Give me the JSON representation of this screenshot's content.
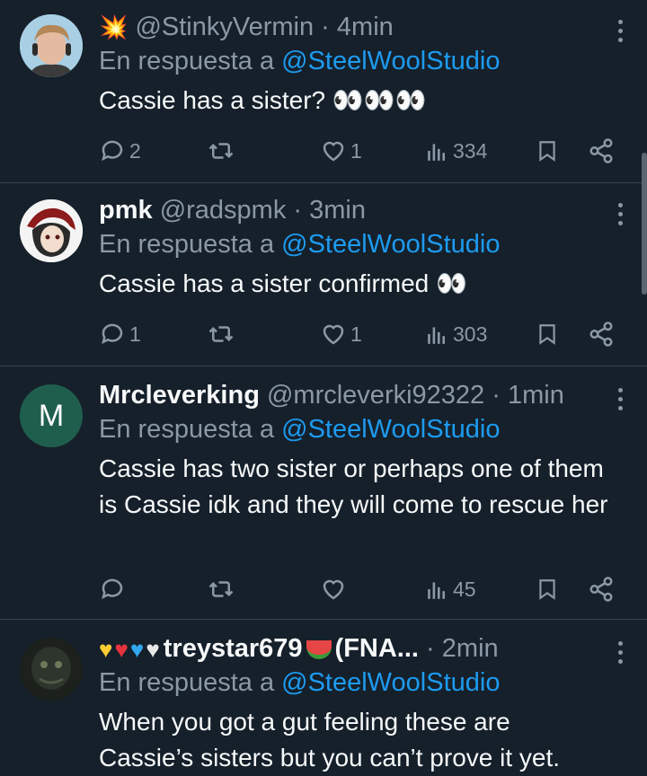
{
  "tweets": [
    {
      "display_name": "",
      "name_prefix_icon": "collision-emoji",
      "handle": "@StinkyVermin",
      "separator": "·",
      "time": "4min",
      "reply_prefix": "En respuesta a",
      "reply_mention": "@SteelWoolStudio",
      "text": "Cassie has a sister? 👀👀👀",
      "replies": "2",
      "retweets": "",
      "likes": "1",
      "views": "334"
    },
    {
      "display_name": "pmk",
      "handle": "@radspmk",
      "separator": "·",
      "time": "3min",
      "reply_prefix": "En respuesta a",
      "reply_mention": "@SteelWoolStudio",
      "text": "Cassie has a sister confirmed 👀",
      "replies": "1",
      "retweets": "",
      "likes": "1",
      "views": "303"
    },
    {
      "display_name": "Mrcleverking",
      "avatar_letter": "M",
      "handle": "@mrcleverki92322",
      "separator": "·",
      "time": "1min",
      "reply_prefix": "En respuesta a",
      "reply_mention": "@SteelWoolStudio",
      "text": "Cassie has two sister or perhaps one of them is Cassie idk and they will come to rescue her",
      "replies": "",
      "retweets": "",
      "likes": "",
      "views": "45"
    },
    {
      "display_name": "treystar679",
      "display_name_suffix": "(FNA...",
      "handle": "",
      "separator": "·",
      "time": "2min",
      "reply_prefix": "En respuesta a",
      "reply_mention": "@SteelWoolStudio",
      "text": "When you got a gut feeling these are Cassie’s sisters but you can’t prove it yet."
    }
  ],
  "colors": {
    "background": "#15202b",
    "accent": "#1d9bf0",
    "muted": "#8b98a5",
    "divider": "#38444d",
    "avatar_m": "#1f5e4d"
  }
}
